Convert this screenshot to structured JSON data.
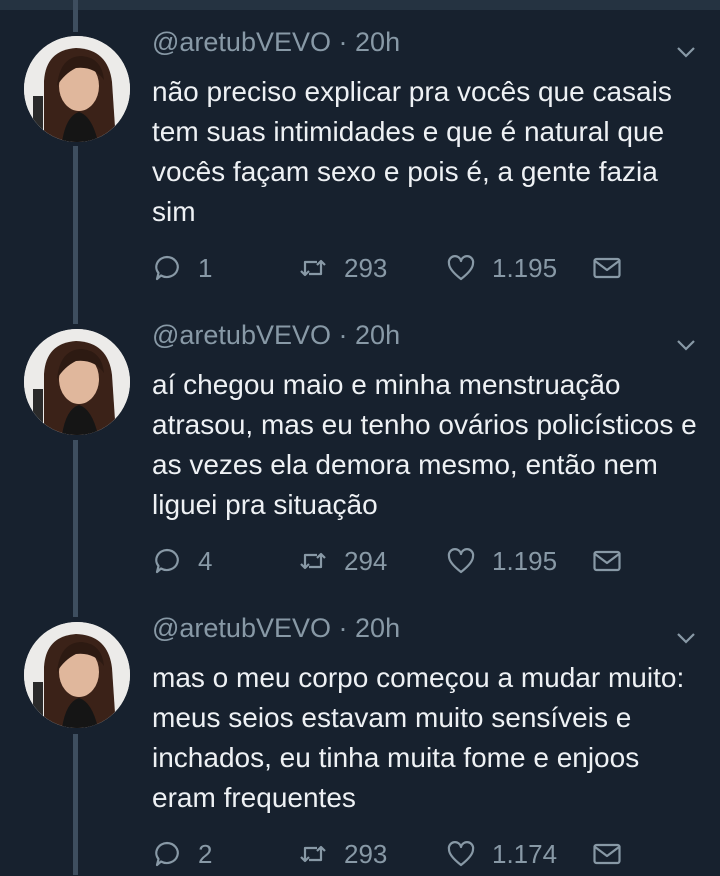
{
  "tweets": [
    {
      "handle": "@aretubVEVO",
      "time": "20h",
      "text": "não preciso explicar pra vocês que casais tem suas intimidades e que é natural que vocês façam sexo e pois é, a gente fazia sim",
      "replies": "1",
      "retweets": "293",
      "likes": "1.195"
    },
    {
      "handle": "@aretubVEVO",
      "time": "20h",
      "text": "aí chegou maio e minha menstruação atrasou, mas eu tenho ovários policísticos e as vezes ela demora mesmo, então nem liguei pra situação",
      "replies": "4",
      "retweets": "294",
      "likes": "1.195"
    },
    {
      "handle": "@aretubVEVO",
      "time": "20h",
      "text": "mas o meu corpo começou a mudar muito: meus seios estavam muito sensíveis e inchados, eu tinha muita fome e enjoos eram frequentes",
      "replies": "2",
      "retweets": "293",
      "likes": "1.174"
    }
  ],
  "separator": "·",
  "icons": {
    "reply": "reply-bubble-icon",
    "retweet": "retweet-icon",
    "like": "heart-icon",
    "dm": "envelope-icon",
    "menu": "chevron-down-icon"
  },
  "colors": {
    "background": "#17212e",
    "text": "#eef1f4",
    "secondary": "#8899a6",
    "thread_line": "#3e4e5f"
  }
}
